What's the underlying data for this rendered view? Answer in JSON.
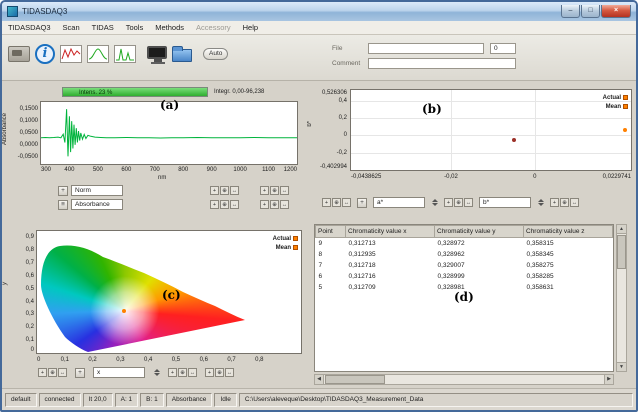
{
  "window": {
    "title": "TIDASDAQ3"
  },
  "menu": {
    "items": [
      {
        "label": "TIDASDAQ3"
      },
      {
        "label": "Scan"
      },
      {
        "label": "TIDAS"
      },
      {
        "label": "Tools"
      },
      {
        "label": "Methods"
      },
      {
        "label": "Accessory"
      },
      {
        "label": "Help"
      }
    ]
  },
  "toolbar": {
    "auto_label": "Auto",
    "file_label": "File",
    "comment_label": "Comment",
    "counter_value": "0"
  },
  "icons": {
    "info_glyph": "i",
    "min_glyph": "–",
    "max_glyph": "□",
    "close_glyph": "×",
    "tool_glyphs": [
      "+",
      "⊕",
      "↔"
    ],
    "tool_names": [
      "crosshair-tool-icon",
      "zoom-tool-icon",
      "pan-tool-icon"
    ],
    "scroll_up": "▲",
    "scroll_down": "▼",
    "scroll_left": "◀",
    "scroll_right": "▶"
  },
  "panel_a": {
    "annotation": "(a)",
    "intens_label": "Intens. 23 %",
    "integr_label": "Integr. 0,00-96,238",
    "y_title": "Absorbance",
    "x_unit": "nm",
    "norm_value": "Norm",
    "mode_value": "Absorbance",
    "chart_data": {
      "type": "line",
      "xlabel": "nm",
      "ylabel": "Absorbance",
      "xlim": [
        300,
        1200
      ],
      "ylim": [
        -0.08,
        0.18
      ],
      "x_tick_vals": [
        300,
        400,
        500,
        600,
        700,
        800,
        900,
        1000,
        1100,
        1200
      ],
      "x_ticks": [
        "300",
        "400",
        "500",
        "600",
        "700",
        "800",
        "900",
        "1000",
        "1100",
        "1200"
      ],
      "y_tick_vals": [
        0.15,
        0.1,
        0.05,
        0.0,
        -0.05
      ],
      "y_ticks": [
        "0,1500",
        "0,1000",
        "0,0500",
        "0,0000",
        "-0,0500"
      ],
      "series": [
        {
          "name": "Absorbance",
          "color": "#00b43c",
          "x": [
            300,
            315,
            330,
            345,
            360,
            370,
            378,
            384,
            390,
            395,
            400,
            404,
            408,
            412,
            416,
            420,
            424,
            428,
            432,
            436,
            440,
            446,
            452,
            458,
            465,
            475,
            490,
            510,
            530,
            560,
            600,
            640,
            680,
            720,
            760,
            800,
            850,
            900,
            950,
            1000,
            1050,
            1100,
            1150,
            1200
          ],
          "y": [
            0.03,
            0.031,
            0.03,
            0.031,
            0.033,
            0.03,
            0.045,
            0.01,
            0.15,
            -0.048,
            0.12,
            -0.03,
            0.1,
            -0.015,
            0.085,
            0.0,
            0.07,
            0.01,
            0.058,
            0.018,
            0.05,
            0.024,
            0.044,
            0.027,
            0.04,
            0.036,
            0.033,
            0.031,
            0.03,
            0.03,
            0.031,
            0.03,
            0.03,
            0.029,
            0.03,
            0.03,
            0.031,
            0.03,
            0.03,
            0.03,
            0.031,
            0.03,
            0.03,
            0.03
          ]
        }
      ]
    }
  },
  "panel_b": {
    "annotation": "(b)",
    "y_axis_title": "b*",
    "a_field_value": "a*",
    "b_field_value": "b*",
    "legend": [
      {
        "label": "Actual",
        "color": "#ff8000"
      },
      {
        "label": "Mean",
        "color": "#ff8000"
      }
    ],
    "chart_data": {
      "type": "scatter",
      "xlim": [
        -0.0438625,
        0.0229741
      ],
      "ylim": [
        -0.402994,
        0.526306
      ],
      "x_tick_vals": [
        -0.0438625,
        -0.02,
        0,
        0.0229741
      ],
      "x_ticks": [
        "-0,0438625",
        "-0,02",
        "0",
        "0,0229741"
      ],
      "y_tick_vals": [
        0.526306,
        0.4,
        0.2,
        0,
        -0.2,
        -0.402994
      ],
      "y_ticks": [
        "0,526306",
        "0,4",
        "0,2",
        "0",
        "-0,2",
        "-0,402994"
      ],
      "x_grid": [
        -0.02,
        0
      ],
      "y_grid": [
        0.4,
        0.2,
        0,
        -0.2
      ],
      "legend_position": "top-right",
      "series": [
        {
          "name": "Actual",
          "color": "#ff8000",
          "points": [
            [
              0.0215,
              0.06
            ]
          ]
        },
        {
          "name": "Mean",
          "color": "#9c3028",
          "points": [
            [
              -0.005,
              -0.06
            ]
          ]
        }
      ]
    }
  },
  "panel_c": {
    "annotation": "(c)",
    "y_title": "y",
    "x_field_value": "x",
    "legend": [
      {
        "label": "Actual",
        "color": "#ff8000"
      },
      {
        "label": "Mean",
        "color": "#ff8000"
      }
    ],
    "chart_data": {
      "type": "chromaticity-diagram",
      "xlim": [
        0,
        0.95
      ],
      "ylim": [
        0,
        0.95
      ],
      "x_tick_vals": [
        0,
        0.1,
        0.2,
        0.3,
        0.4,
        0.5,
        0.6,
        0.7,
        0.8
      ],
      "x_ticks": [
        "0",
        "0,1",
        "0,2",
        "0,3",
        "0,4",
        "0,5",
        "0,6",
        "0,7",
        "0,8"
      ],
      "y_tick_vals": [
        0,
        0.1,
        0.2,
        0.3,
        0.4,
        0.5,
        0.6,
        0.7,
        0.8,
        0.9
      ],
      "y_ticks": [
        "0",
        "0,1",
        "0,2",
        "0,3",
        "0,4",
        "0,5",
        "0,6",
        "0,7",
        "0,8",
        "0,9"
      ],
      "series": [
        {
          "name": "Actual",
          "color": "#ff8000",
          "points": [
            [
              0.313,
              0.329
            ]
          ]
        }
      ]
    }
  },
  "panel_d": {
    "annotation": "(d)",
    "table": {
      "columns": [
        "Point",
        "Chromaticity value x",
        "Chromaticity value y",
        "Chromaticity value z"
      ],
      "rows": [
        [
          "9",
          "0,312713",
          "0,328972",
          "0,358315"
        ],
        [
          "8",
          "0,312935",
          "0,328962",
          "0,358345"
        ],
        [
          "7",
          "0,312718",
          "0,329007",
          "0,358275"
        ],
        [
          "6",
          "0,312716",
          "0,328999",
          "0,358285"
        ],
        [
          "5",
          "0,312709",
          "0,328981",
          "0,358631"
        ]
      ]
    }
  },
  "status_bar": {
    "items": [
      "default",
      "connected",
      "It 20,0",
      "A: 1",
      "B: 1",
      "Absorbance",
      "Idle"
    ],
    "path": "C:\\Users\\aleveque\\Desktop\\TIDASDAQ3_Measurement_Data"
  },
  "colors": {
    "marker_orange": "#ff8000",
    "progress_green": "#2fae2f",
    "spectrum_green": "#00b43c"
  }
}
